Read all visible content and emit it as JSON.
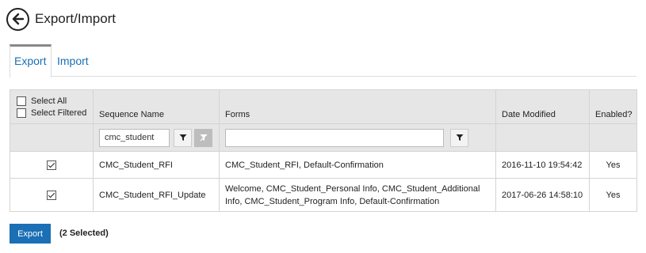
{
  "header": {
    "title": "Export/Import"
  },
  "tabs": [
    {
      "label": "Export",
      "active": true
    },
    {
      "label": "Import",
      "active": false
    }
  ],
  "table": {
    "select_all_label": "Select All",
    "select_filtered_label": "Select Filtered",
    "columns": [
      "Sequence Name",
      "Forms",
      "Date Modified",
      "Enabled?"
    ],
    "filters": {
      "sequence_name_value": "cmc_student",
      "forms_value": ""
    },
    "rows": [
      {
        "checked": true,
        "sequence_name": "CMC_Student_RFI",
        "forms": "CMC_Student_RFI, Default-Confirmation",
        "date_modified": "2016-11-10 19:54:42",
        "enabled": "Yes"
      },
      {
        "checked": true,
        "sequence_name": "CMC_Student_RFI_Update",
        "forms": "Welcome, CMC_Student_Personal Info, CMC_Student_Additional Info, CMC_Student_Program Info, Default-Confirmation",
        "date_modified": "2017-06-26 14:58:10",
        "enabled": "Yes"
      }
    ]
  },
  "footer": {
    "export_label": "Export",
    "selected_text": "(2 Selected)"
  },
  "colors": {
    "accent": "#1a6fb5",
    "header_bg": "#e6e6e6"
  }
}
